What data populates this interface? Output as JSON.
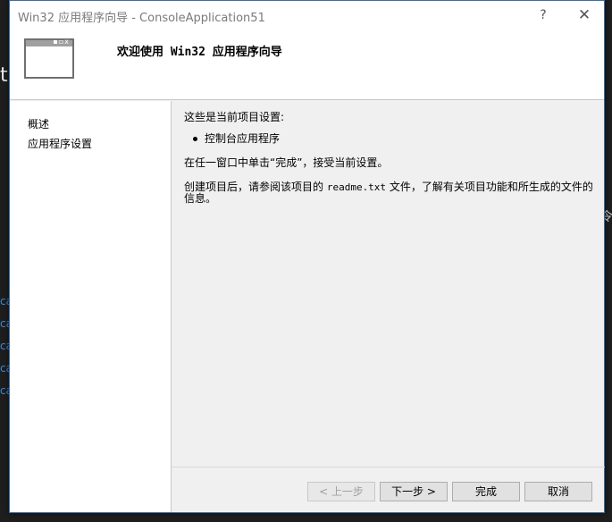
{
  "background": {
    "fragment_tu": "tu",
    "fragment_right": "令",
    "fragment_blue": [
      "ca",
      "ca",
      "ca",
      "ca",
      "ca"
    ]
  },
  "window": {
    "title": "Win32 应用程序向导 - ConsoleApplication51",
    "help_label": "?",
    "close_label": "✕"
  },
  "header": {
    "title": "欢迎使用 Win32 应用程序向导",
    "icon_dots": "▪▫x"
  },
  "nav": {
    "items": [
      {
        "label": "概述"
      },
      {
        "label": "应用程序设置"
      }
    ]
  },
  "content": {
    "settings_intro": "这些是当前项目设置:",
    "bullet": "控制台应用程序",
    "finish_hint": "在任一窗口中单击“完成”，接受当前设置。",
    "readme_part1": "创建项目后，请参阅该项目的 ",
    "readme_file": "readme.txt",
    "readme_part2": " 文件，了解有关项目功能和所生成的文件的信息。"
  },
  "buttons": {
    "prev": "< 上一步",
    "next": "下一步 >",
    "finish": "完成",
    "cancel": "取消"
  },
  "colors": {
    "accent_border": "#3a6ea5",
    "dialog_bg": "#f0f0f0",
    "background_ide": "#1e1e1e"
  }
}
